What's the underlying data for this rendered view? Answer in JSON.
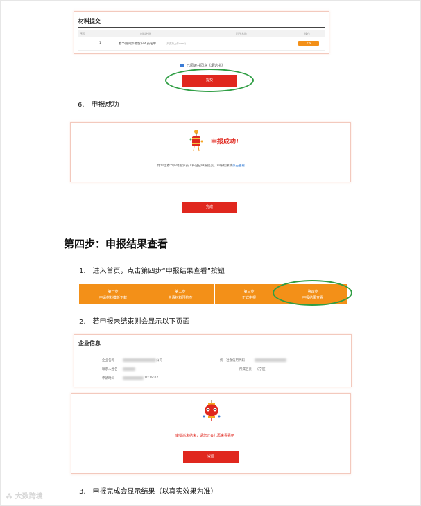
{
  "materials": {
    "title": "材料提交",
    "headers": [
      "序号",
      "材料名称",
      "附件名称",
      "操作"
    ],
    "row": {
      "index": "1",
      "name": "春节期间外地留沪人员名单",
      "note": "(只支持上传word)",
      "action": "上传"
    }
  },
  "agreement": {
    "checkbox_text": "已阅读并同意《承诺书》"
  },
  "submit_button": "提交",
  "step6": {
    "num": "6.",
    "text": "申报成功"
  },
  "success": {
    "title": "申报成功!",
    "desc": "你单位春节外地留沪员工补贴已申报提交，审核结果请",
    "link": "点击查看"
  },
  "done_button": "完成",
  "section_heading": "第四步：申报结果查看",
  "step1": {
    "num": "1.",
    "text": "进入首页，点击第四步“申报结果查看”按钮"
  },
  "step_buttons": [
    {
      "line1": "第一步",
      "line2": "申请材料模板下载"
    },
    {
      "line1": "第二步",
      "line2": "申请材料预检查"
    },
    {
      "line1": "第三步",
      "line2": "正式申报"
    },
    {
      "line1": "第四步",
      "line2": "申报结果查看"
    }
  ],
  "step2": {
    "num": "2.",
    "text": "若申报未结束则会显示以下页面"
  },
  "company": {
    "title": "企业信息",
    "labels": {
      "name": "企业名称",
      "credit_code": "统一社会信用代码",
      "contact": "联系人姓名",
      "district": "所属区县",
      "apply_time": "申请时间"
    },
    "values": {
      "name_suffix": "公司",
      "district": "长宁区",
      "time_suffix": "10:18:07"
    }
  },
  "notdone": {
    "text": "审批尚未结束，请您过会儿再来看看吧"
  },
  "return_button": "返回",
  "step3": {
    "num": "3.",
    "text": "申报完成会显示结果（以真实效果为准）"
  },
  "watermark": "大数跨境",
  "colors": {
    "accent_red": "#e0271e",
    "orange": "#f39018",
    "highlight_green": "#2f9e44"
  }
}
